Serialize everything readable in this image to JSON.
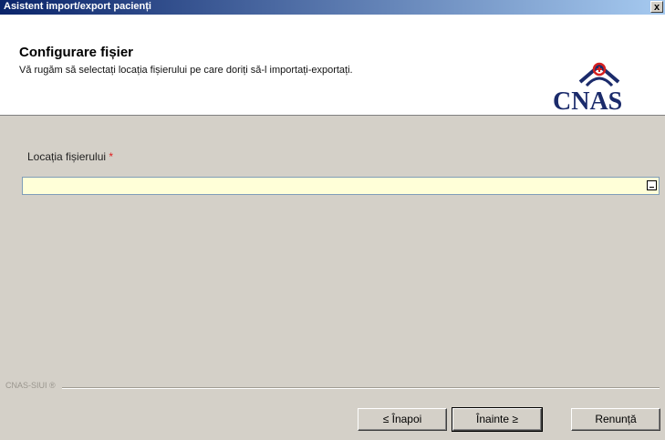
{
  "window": {
    "title": "Asistent import/export pacienți",
    "close_label": "x"
  },
  "header": {
    "title": "Configurare fișier",
    "subtitle": "Vă rugăm să selectați locația fișierului pe care doriți să-l importați-exportați.",
    "logo_text": "CNAS",
    "logo_colors": {
      "red": "#d42020",
      "blue": "#1b2b6b"
    }
  },
  "form": {
    "location_label": "Locația fișierului",
    "required_marker": "*",
    "location_value": ""
  },
  "footer": {
    "brand_label": "CNAS-SIUI ®"
  },
  "buttons": {
    "back_label": "≤ Înapoi",
    "next_label": "Înainte ≥",
    "cancel_label": "Renunță"
  }
}
